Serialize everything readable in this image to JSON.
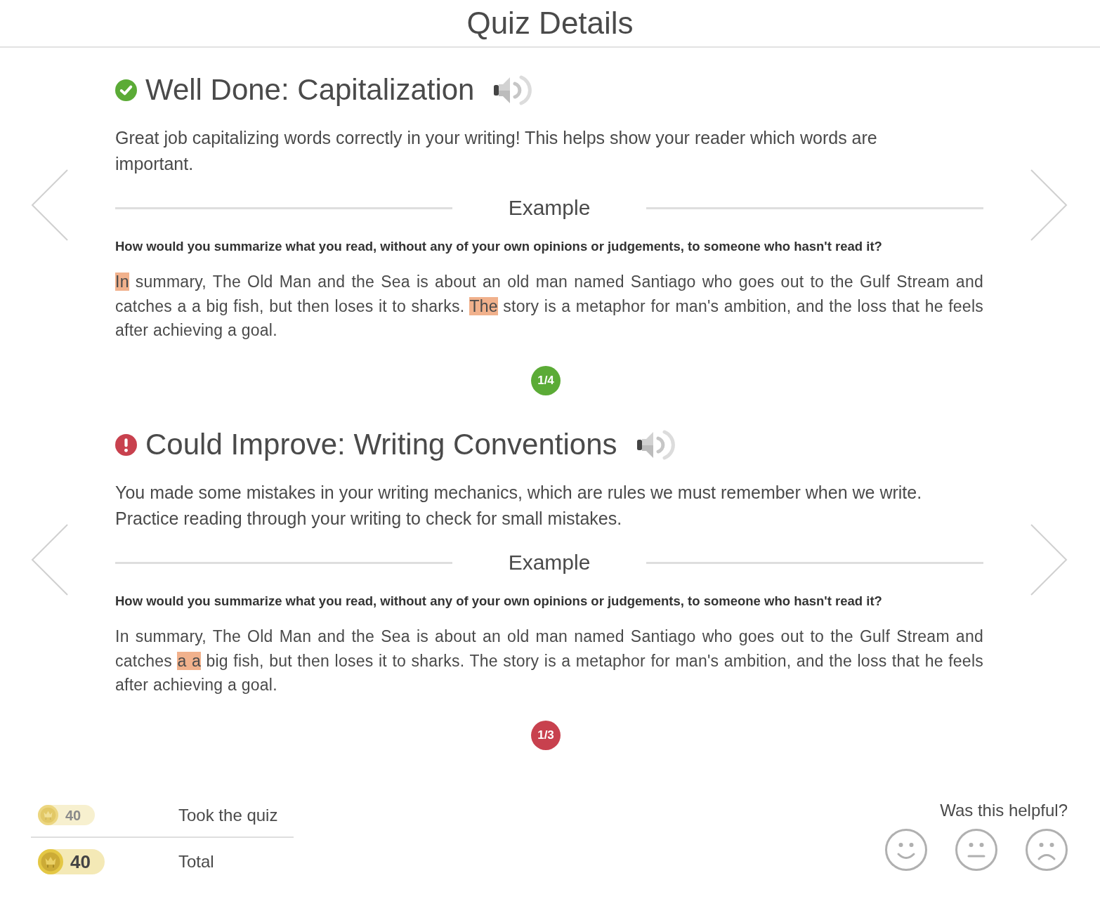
{
  "header": {
    "title": "Quiz Details"
  },
  "feedback": [
    {
      "kind": "success",
      "title": "Well Done: Capitalization",
      "description": "Great job capitalizing words correctly in your writing! This helps show your reader which words are important.",
      "example_label": "Example",
      "question": "How would you summarize what you read, without any of your own opinions or judgements, to someone who hasn't read it?",
      "answer": [
        {
          "text": "In",
          "highlighted": true
        },
        {
          "text": " summary, The Old Man and the Sea is about an old man named Santiago who goes out to the Gulf Stream and catches a a big fish, but then loses it to sharks. ",
          "highlighted": false
        },
        {
          "text": "The",
          "highlighted": true
        },
        {
          "text": " story is a metaphor for man's ambition, and the loss that he feels after achieving a goal.",
          "highlighted": false
        }
      ],
      "pager": "1/4"
    },
    {
      "kind": "warning",
      "title": "Could Improve: Writing Conventions",
      "description": "You made some mistakes in your writing mechanics, which are rules we must remember when we write. Practice reading through your writing to check for small mistakes.",
      "example_label": "Example",
      "question": "How would you summarize what you read, without any of your own opinions or judgements, to someone who hasn't read it?",
      "answer": [
        {
          "text": "In summary, The Old Man and the Sea is about an old man named Santiago who goes out to the Gulf Stream and catches ",
          "highlighted": false
        },
        {
          "text": "a a",
          "highlighted": true
        },
        {
          "text": " big fish, but then loses it to sharks. The story is a metaphor for man's ambition, and the loss that he feels after achieving a goal.",
          "highlighted": false
        }
      ],
      "pager": "1/3"
    }
  ],
  "rewards": [
    {
      "kind": "item",
      "amount": "40",
      "label": "Took the quiz"
    },
    {
      "kind": "total",
      "amount": "40",
      "label": "Total"
    }
  ],
  "helpful": {
    "prompt": "Was this helpful?",
    "options": [
      {
        "kind": "happy",
        "selected": false
      },
      {
        "kind": "neutral",
        "selected": false
      },
      {
        "kind": "sad",
        "selected": false
      }
    ]
  }
}
